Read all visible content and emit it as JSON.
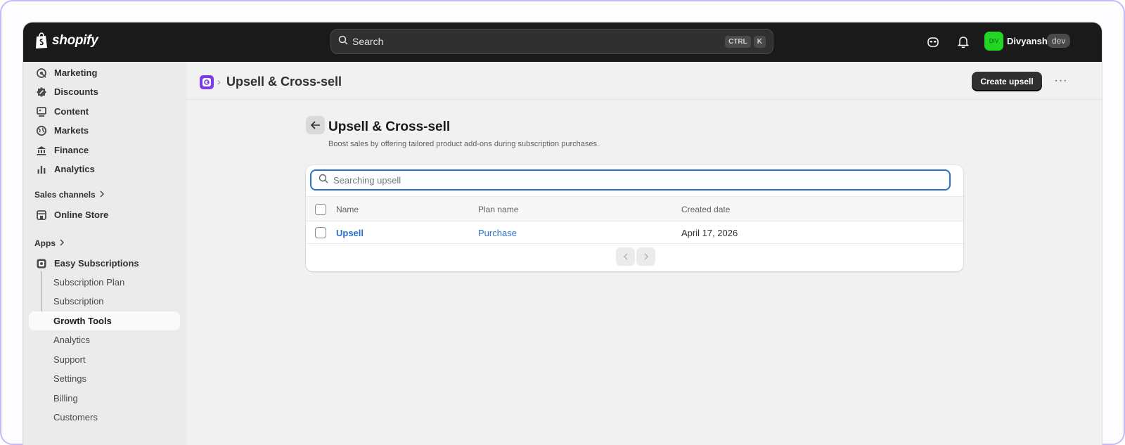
{
  "app": {
    "brand": "shopify",
    "accent": "#2c6ecb",
    "app_icon_color": "#7c3aed"
  },
  "topbar": {
    "search_placeholder": "Search",
    "shortcut_keys": [
      "CTRL",
      "K"
    ],
    "avatar_initials": "DIV",
    "username": "Divyansh",
    "env_badge": "dev",
    "icons": [
      "sidekick-icon",
      "bell-icon"
    ]
  },
  "sidebar": {
    "items": [
      {
        "label": "Marketing",
        "icon": "target-icon"
      },
      {
        "label": "Discounts",
        "icon": "discount-icon"
      },
      {
        "label": "Content",
        "icon": "content-icon"
      },
      {
        "label": "Markets",
        "icon": "globe-icon"
      },
      {
        "label": "Finance",
        "icon": "bank-icon"
      },
      {
        "label": "Analytics",
        "icon": "bar-chart-icon"
      }
    ],
    "sales_channels_title": "Sales channels",
    "online_store": "Online Store",
    "apps_title": "Apps",
    "app_name": "Easy Subscriptions",
    "app_sub_items": [
      "Subscription Plan",
      "Subscription",
      "Growth Tools",
      "Analytics",
      "Support",
      "Settings",
      "Billing",
      "Customers"
    ],
    "active_sub_item": "Growth Tools"
  },
  "header": {
    "title": "Upsell & Cross-sell",
    "primary_action": "Create upsell",
    "more_label": "···"
  },
  "content": {
    "title": "Upsell & Cross-sell",
    "description": "Boost sales by offering tailored product add-ons during subscription purchases.",
    "search_placeholder": "Searching upsell",
    "columns": [
      "Name",
      "Plan name",
      "Created date"
    ],
    "rows": [
      {
        "name": "Upsell",
        "plan_name": "Purchase",
        "created_date": "April 17, 2026"
      }
    ]
  }
}
